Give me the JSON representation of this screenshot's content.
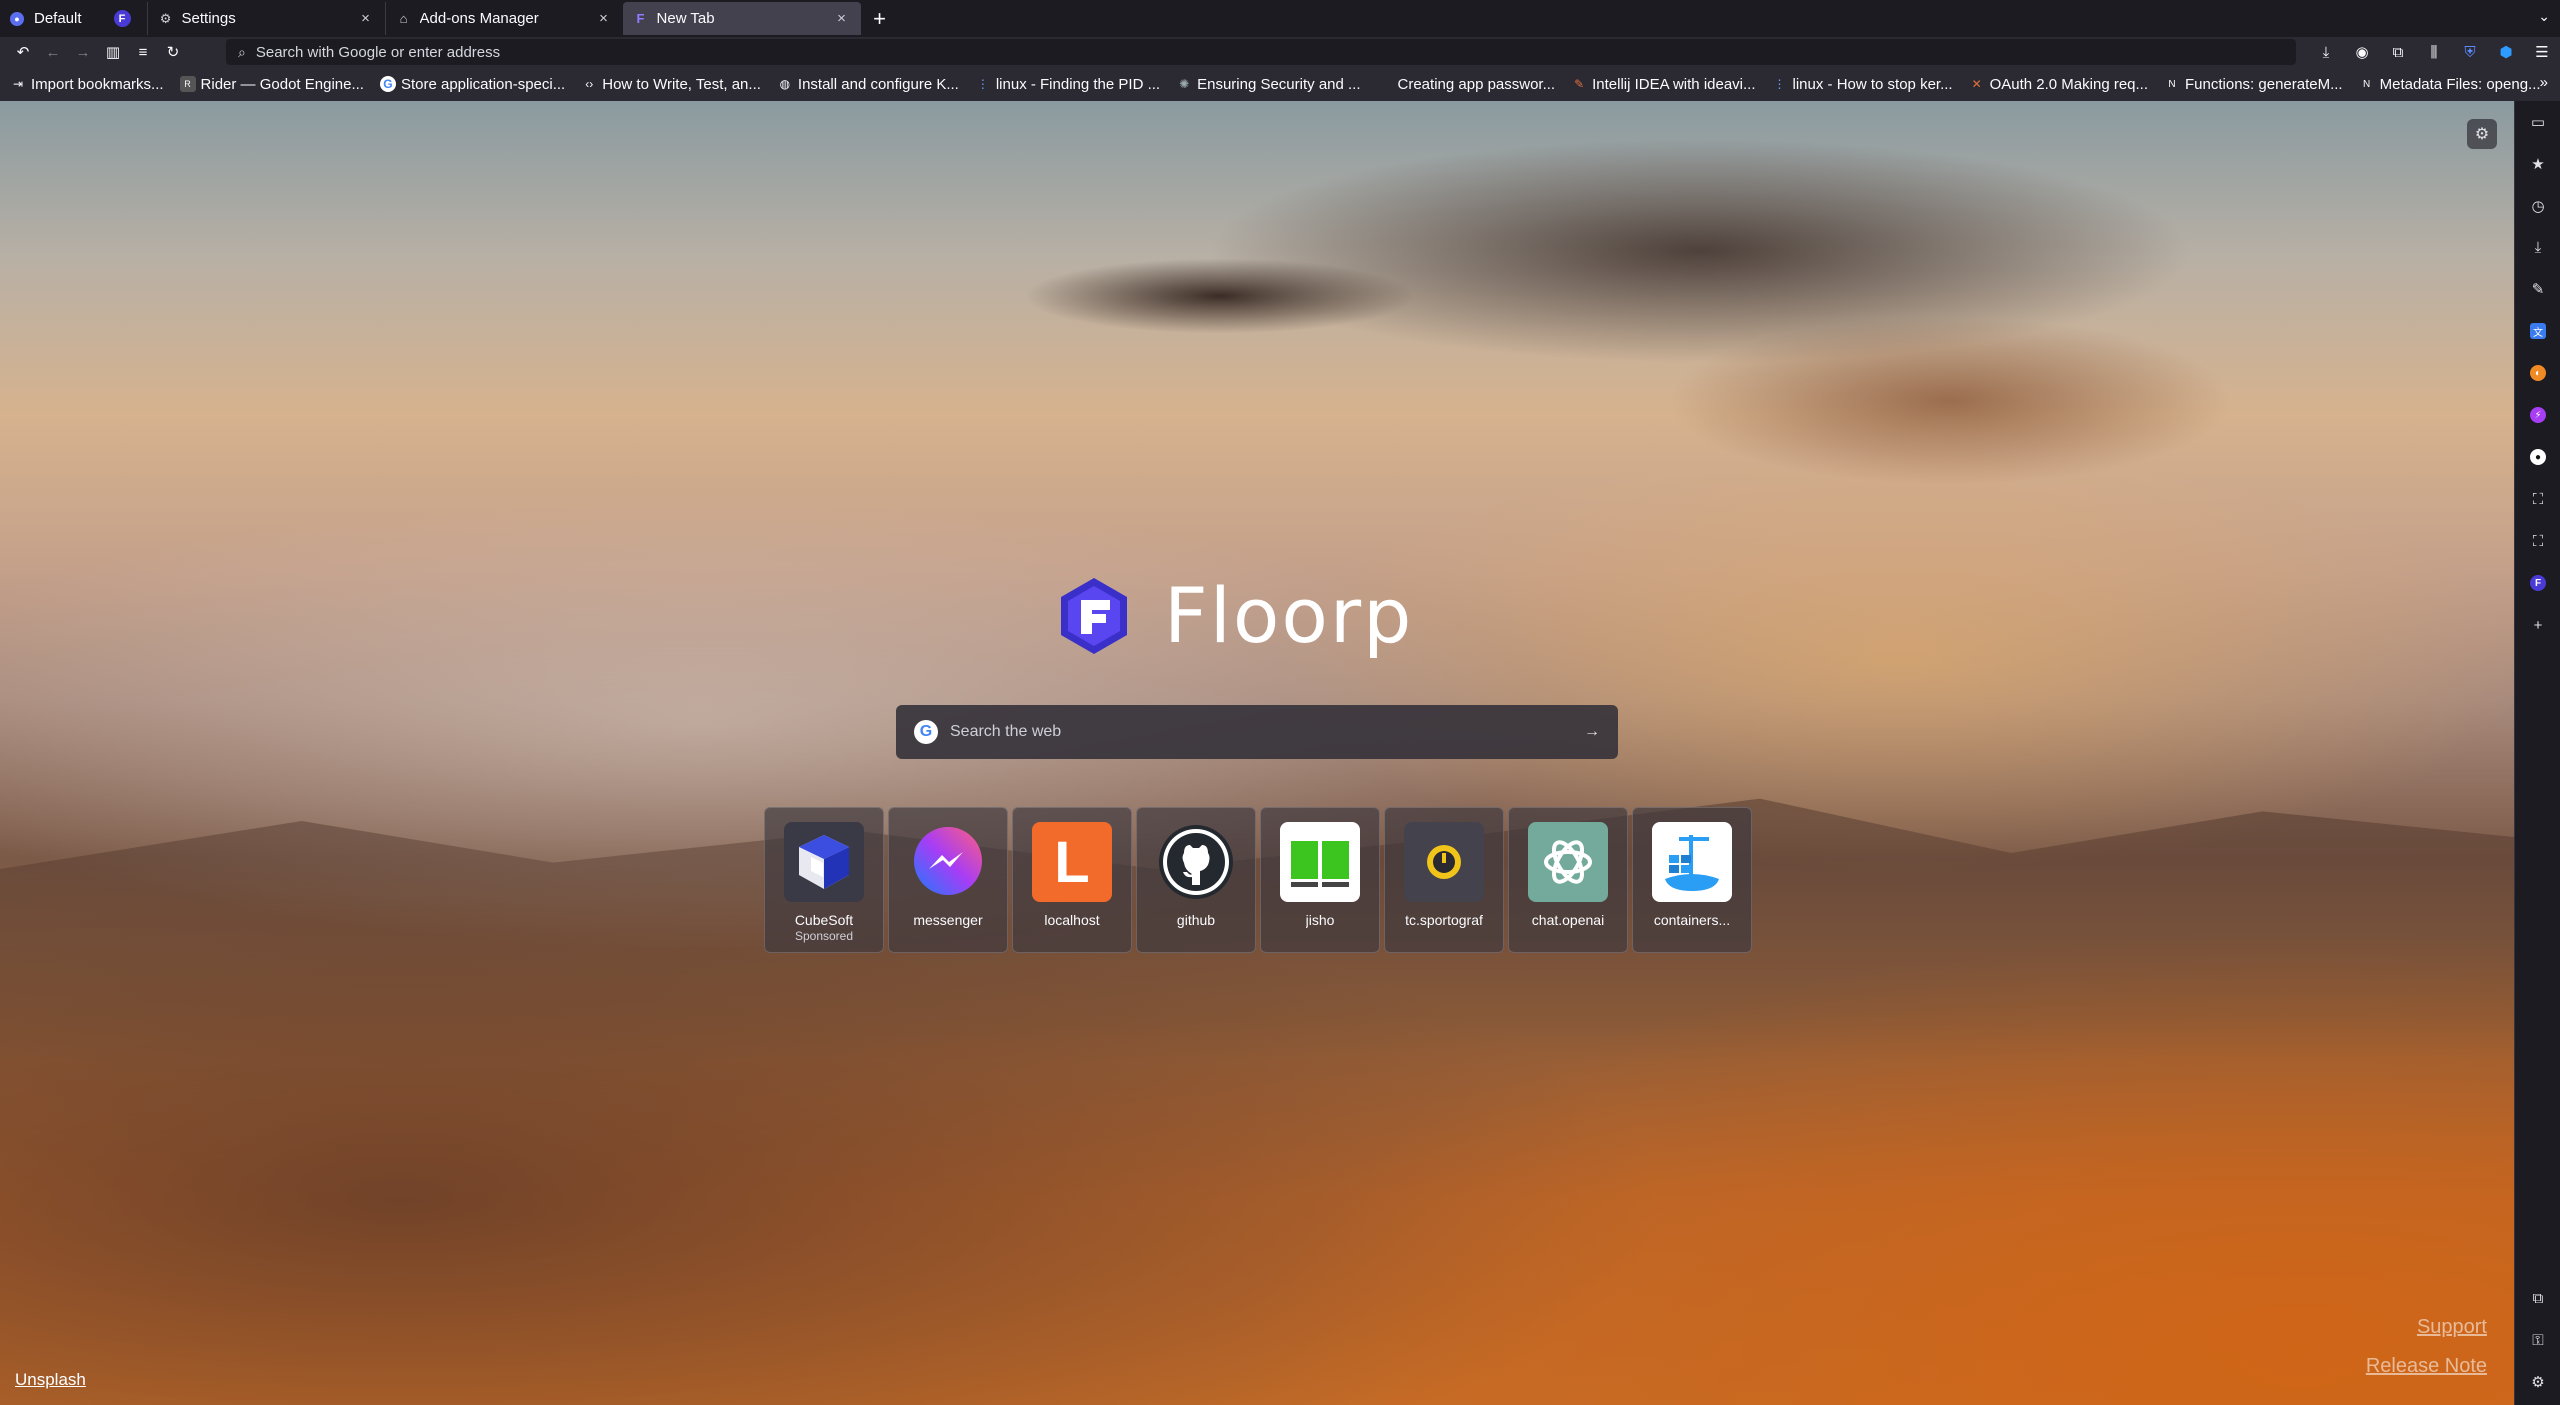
{
  "tabbar": {
    "workspace_label": "Default",
    "tabs": [
      {
        "title": "Settings",
        "icon": "gear-icon"
      },
      {
        "title": "Add-ons Manager",
        "icon": "puzzle-icon"
      },
      {
        "title": "New Tab",
        "icon": "floorp-icon",
        "active": true
      }
    ]
  },
  "navbar": {
    "url_placeholder": "Search with Google or enter address"
  },
  "bookmarks": [
    {
      "label": "Import bookmarks...",
      "icon": "import-icon"
    },
    {
      "label": "Rider — Godot Engine...",
      "icon": "rider-icon"
    },
    {
      "label": "Store application-speci...",
      "icon": "google-icon"
    },
    {
      "label": "How to Write, Test, an...",
      "icon": "code-icon"
    },
    {
      "label": "Install and configure K...",
      "icon": "globe-icon"
    },
    {
      "label": "linux - Finding the PID ...",
      "icon": "stackexchange-icon"
    },
    {
      "label": "Ensuring Security and ...",
      "icon": "gear-icon"
    },
    {
      "label": "Creating app passwor...",
      "icon": "blank-icon"
    },
    {
      "label": "Intellij IDEA with ideavi...",
      "icon": "pen-icon"
    },
    {
      "label": "linux - How to stop ker...",
      "icon": "stackexchange-icon"
    },
    {
      "label": "OAuth 2.0 Making req...",
      "icon": "x-icon"
    },
    {
      "label": "Functions: generateM...",
      "icon": "notion-icon"
    },
    {
      "label": "Metadata Files: openg...",
      "icon": "notion-icon"
    }
  ],
  "newtab": {
    "brand": "Floorp",
    "search_placeholder": "Search the web",
    "top_sites": [
      {
        "label": "CubeSoft",
        "sub": "Sponsored",
        "icon": "cubesoft-icon"
      },
      {
        "label": "messenger",
        "sub": "",
        "icon": "messenger-icon"
      },
      {
        "label": "localhost",
        "sub": "",
        "icon": "localhost-icon"
      },
      {
        "label": "github",
        "sub": "",
        "icon": "github-icon"
      },
      {
        "label": "jisho",
        "sub": "",
        "icon": "jisho-icon"
      },
      {
        "label": "tc.sportograf",
        "sub": "",
        "icon": "sportograf-icon"
      },
      {
        "label": "chat.openai",
        "sub": "",
        "icon": "openai-icon"
      },
      {
        "label": "containers...",
        "sub": "",
        "icon": "containers-icon"
      }
    ],
    "footer": {
      "credit": "Unsplash",
      "support": "Support",
      "release_note": "Release Note"
    }
  },
  "colors": {
    "chrome_dark": "#1c1b22",
    "toolbar": "#2b2a33",
    "active_tab": "#42414d",
    "floorp_purple": "#4b3bd6"
  }
}
